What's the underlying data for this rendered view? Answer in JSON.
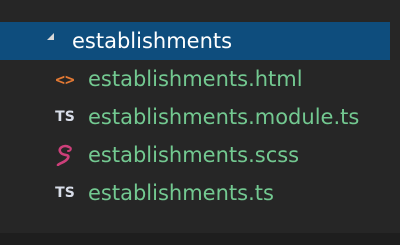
{
  "explorer": {
    "folder": {
      "label": "establishments",
      "expanded": true,
      "icon": "chevron-down-icon"
    },
    "files": [
      {
        "name": "establishments.html",
        "icon": "html-file-icon",
        "icon_glyph": "<>",
        "icon_color": "#e37933"
      },
      {
        "name": "establishments.module.ts",
        "icon": "typescript-file-icon",
        "icon_glyph": "TS",
        "icon_color": "#d8dde8"
      },
      {
        "name": "establishments.scss",
        "icon": "scss-file-icon",
        "icon_color": "#cd3f7a"
      },
      {
        "name": "establishments.ts",
        "icon": "typescript-file-icon",
        "icon_glyph": "TS",
        "icon_color": "#d8dde8"
      }
    ],
    "colors": {
      "selection": "#0e4d7d",
      "file_label": "#73c991",
      "background": "#262626"
    }
  }
}
